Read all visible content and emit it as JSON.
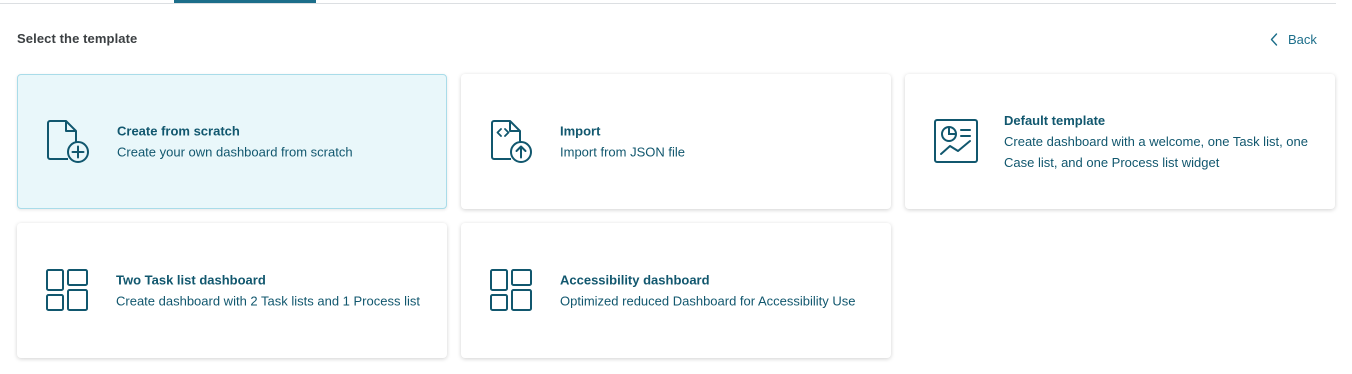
{
  "header": {
    "section_title": "Select the template",
    "back_label": "Back"
  },
  "colors": {
    "accent": "#1c6e8a",
    "text_primary": "#11576e",
    "selected_bg": "#e9f7fa"
  },
  "templates": [
    {
      "title": "Create from scratch",
      "description": "Create your own dashboard from scratch",
      "icon": "file-plus-icon",
      "selected": true
    },
    {
      "title": "Import",
      "description": "Import from JSON file",
      "icon": "file-code-upload-icon",
      "selected": false
    },
    {
      "title": "Default template",
      "description": "Create dashboard with a welcome, one Task list, one Case list, and one Process list widget",
      "icon": "presentation-chart-icon",
      "selected": false
    },
    {
      "title": "Two Task list dashboard",
      "description": "Create dashboard with 2 Task lists and 1 Process list",
      "icon": "layout-grid-icon",
      "selected": false
    },
    {
      "title": "Accessibility dashboard",
      "description": "Optimized reduced Dashboard for Accessibility Use",
      "icon": "layout-grid-icon",
      "selected": false
    }
  ]
}
